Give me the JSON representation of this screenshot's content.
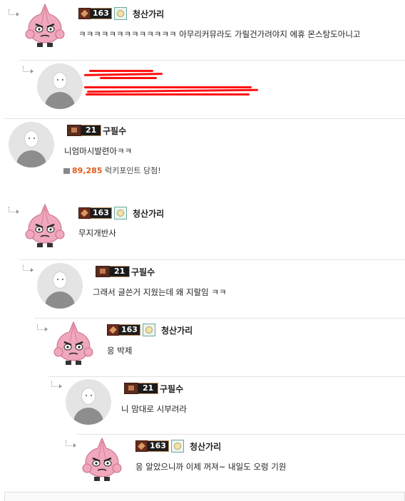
{
  "comments": [
    {
      "id": "c1",
      "name": "청산가리",
      "level": "163",
      "text": "ㅋㅋㅋㅋㅋㅋㅋㅋㅋㅋㅋㅋㅋ 아무리커뮤라도 가릴건가려야지 에휴 몬스탕도아니고"
    },
    {
      "id": "c2",
      "name": "",
      "level": "",
      "text": ""
    },
    {
      "id": "c3",
      "name": "구필수",
      "level": "21",
      "text": "니엄마시발련아ㅋㅋ",
      "lucky_points": "89,285",
      "lucky_text": "럭키포인트 당첨!"
    },
    {
      "id": "c4",
      "name": "청산가리",
      "level": "163",
      "text": "무지개반사"
    },
    {
      "id": "c5",
      "name": "구필수",
      "level": "21",
      "text": "그래서 글쓴거 지웠는데 왜 지랄임 ㅋㅋ"
    },
    {
      "id": "c6",
      "name": "청산가리",
      "level": "163",
      "text": "응 박제"
    },
    {
      "id": "c7",
      "name": "구필수",
      "level": "21",
      "text": "니 맘대로 시부려라"
    },
    {
      "id": "c8",
      "name": "청산가리",
      "level": "163",
      "text": "응 알았으니까 이제 꺼져~ 내일도 오렁 기원"
    }
  ],
  "colors": {
    "lucky_points": "#e25a1c",
    "redaction": "#ff1010",
    "divider": "#e3e3e3"
  },
  "icons": [
    "reply-arrow-icon",
    "level-badge-icon",
    "guild-emblem-icon",
    "gift-icon",
    "garlic-avatar",
    "default-avatar"
  ]
}
